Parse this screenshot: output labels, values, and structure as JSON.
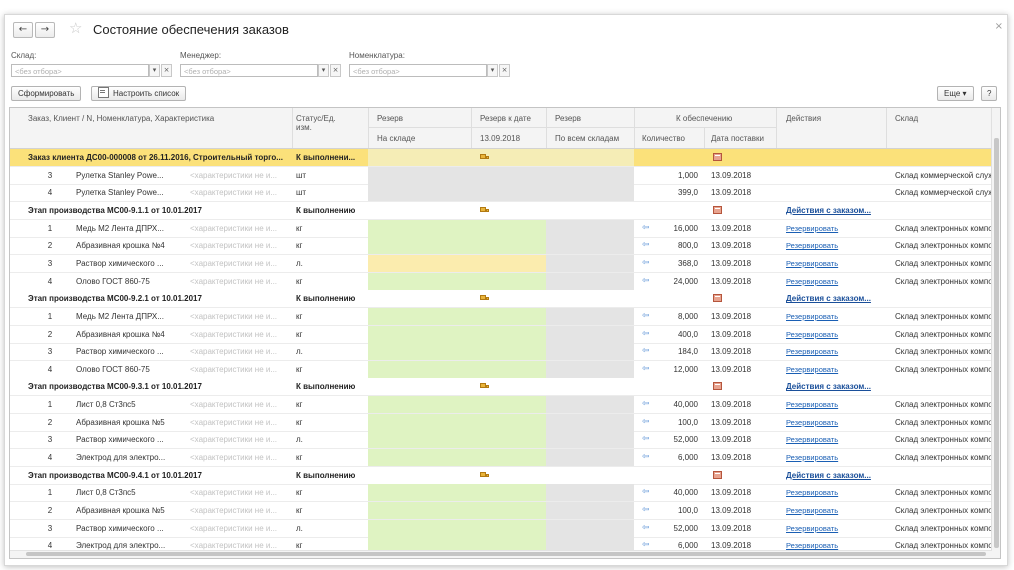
{
  "window": {
    "title": "Состояние обеспечения заказов",
    "back": "←",
    "forward": "→",
    "star": "☆",
    "close": "×"
  },
  "filters": [
    {
      "label": "Склад:",
      "placeholder": "<без отбора>"
    },
    {
      "label": "Менеджер:",
      "placeholder": "<без отбора>"
    },
    {
      "label": "Номенклатура:",
      "placeholder": "<без отбора>"
    }
  ],
  "filter_btn_dropdown": "▾",
  "filter_btn_clear": "×",
  "toolbar": {
    "generate": "Сформировать",
    "configure": "Настроить список",
    "more": "Еще",
    "more_arrow": "▾",
    "help": "?"
  },
  "columns": {
    "order": "Заказ, Клиент / N, Номенклатура, Характеристика",
    "status": "Статус/Ед.",
    "status2": "изм.",
    "reserve": "Резерв",
    "reserve_date": "Резерв к дате",
    "reserve_all": "Резерв",
    "to_supply": "К обеспечению",
    "actions": "Действия",
    "warehouse": "Склад",
    "sub_in_stock": "На складе",
    "sub_date": "13.09.2018",
    "sub_all_wh": "По всем складам",
    "sub_qty": "Количество",
    "sub_delivery": "Дата поставки"
  },
  "rows": [
    {
      "type": "order",
      "title": "Заказ клиента ДС00-000008 от 26.11.2016, Строительный торго...",
      "status": "К выполнени..."
    },
    {
      "type": "item",
      "n": "3",
      "name": "Рулетка Stanley Powe...",
      "char": "<характеристики не и...",
      "unit": "шт",
      "fill": "grey",
      "qty": "1,000",
      "date": "13.09.2018",
      "warehouse": "Склад коммерческой служ",
      "arrow": false,
      "action": ""
    },
    {
      "type": "item",
      "n": "4",
      "name": "Рулетка Stanley Powe...",
      "char": "<характеристики не и...",
      "unit": "шт",
      "fill": "grey",
      "qty": "399,0",
      "date": "13.09.2018",
      "warehouse": "Склад коммерческой служ",
      "arrow": false,
      "action": ""
    },
    {
      "type": "stage",
      "title": "Этап производства МС00-9.1.1 от 10.01.2017",
      "status": "К выполнению",
      "action": "Действия с заказом..."
    },
    {
      "type": "item",
      "n": "1",
      "name": "Медь М2 Лента ДПРХ...",
      "char": "<характеристики не и...",
      "unit": "кг",
      "fill": "green",
      "qty": "16,000",
      "date": "13.09.2018",
      "warehouse": "Склад электронных компо",
      "arrow": true,
      "action": "Резервировать"
    },
    {
      "type": "item",
      "n": "2",
      "name": "Абразивная крошка №4",
      "char": "<характеристики не и...",
      "unit": "кг",
      "fill": "green",
      "qty": "800,0",
      "date": "13.09.2018",
      "warehouse": "Склад электронных компо",
      "arrow": true,
      "action": "Резервировать"
    },
    {
      "type": "item",
      "n": "3",
      "name": "Раствор химического ...",
      "char": "<характеристики не и...",
      "unit": "л.",
      "fill": "yellow",
      "qty": "368,0",
      "date": "13.09.2018",
      "warehouse": "Склад электронных компо",
      "arrow": true,
      "action": "Резервировать"
    },
    {
      "type": "item",
      "n": "4",
      "name": "Олово ГОСТ 860-75",
      "char": "<характеристики не и...",
      "unit": "кг",
      "fill": "green",
      "qty": "24,000",
      "date": "13.09.2018",
      "warehouse": "Склад электронных компо",
      "arrow": true,
      "action": "Резервировать"
    },
    {
      "type": "stage",
      "title": "Этап производства МС00-9.2.1 от 10.01.2017",
      "status": "К выполнению",
      "action": "Действия с заказом..."
    },
    {
      "type": "item",
      "n": "1",
      "name": "Медь М2 Лента ДПРХ...",
      "char": "<характеристики не и...",
      "unit": "кг",
      "fill": "green",
      "qty": "8,000",
      "date": "13.09.2018",
      "warehouse": "Склад электронных компо",
      "arrow": true,
      "action": "Резервировать"
    },
    {
      "type": "item",
      "n": "2",
      "name": "Абразивная крошка №4",
      "char": "<характеристики не и...",
      "unit": "кг",
      "fill": "green",
      "qty": "400,0",
      "date": "13.09.2018",
      "warehouse": "Склад электронных компо",
      "arrow": true,
      "action": "Резервировать"
    },
    {
      "type": "item",
      "n": "3",
      "name": "Раствор химического ...",
      "char": "<характеристики не и...",
      "unit": "л.",
      "fill": "green",
      "qty": "184,0",
      "date": "13.09.2018",
      "warehouse": "Склад электронных компо",
      "arrow": true,
      "action": "Резервировать"
    },
    {
      "type": "item",
      "n": "4",
      "name": "Олово ГОСТ 860-75",
      "char": "<характеристики не и...",
      "unit": "кг",
      "fill": "green",
      "qty": "12,000",
      "date": "13.09.2018",
      "warehouse": "Склад электронных компо",
      "arrow": true,
      "action": "Резервировать"
    },
    {
      "type": "stage",
      "title": "Этап производства МС00-9.3.1 от 10.01.2017",
      "status": "К выполнению",
      "action": "Действия с заказом..."
    },
    {
      "type": "item",
      "n": "1",
      "name": "Лист 0,8 Ст3пс5",
      "char": "<характеристики не и...",
      "unit": "кг",
      "fill": "green",
      "qty": "40,000",
      "date": "13.09.2018",
      "warehouse": "Склад электронных компо",
      "arrow": true,
      "action": "Резервировать"
    },
    {
      "type": "item",
      "n": "2",
      "name": "Абразивная крошка №5",
      "char": "<характеристики не и...",
      "unit": "кг",
      "fill": "green",
      "qty": "100,0",
      "date": "13.09.2018",
      "warehouse": "Склад электронных компо",
      "arrow": true,
      "action": "Резервировать"
    },
    {
      "type": "item",
      "n": "3",
      "name": "Раствор химического ...",
      "char": "<характеристики не и...",
      "unit": "л.",
      "fill": "green",
      "qty": "52,000",
      "date": "13.09.2018",
      "warehouse": "Склад электронных компо",
      "arrow": true,
      "action": "Резервировать"
    },
    {
      "type": "item",
      "n": "4",
      "name": "Электрод для электро...",
      "char": "<характеристики не и...",
      "unit": "кг",
      "fill": "green",
      "qty": "6,000",
      "date": "13.09.2018",
      "warehouse": "Склад электронных компо",
      "arrow": true,
      "action": "Резервировать"
    },
    {
      "type": "stage",
      "title": "Этап производства МС00-9.4.1 от 10.01.2017",
      "status": "К выполнению",
      "action": "Действия с заказом..."
    },
    {
      "type": "item",
      "n": "1",
      "name": "Лист 0,8 Ст3пс5",
      "char": "<характеристики не и...",
      "unit": "кг",
      "fill": "green",
      "qty": "40,000",
      "date": "13.09.2018",
      "warehouse": "Склад электронных компо",
      "arrow": true,
      "action": "Резервировать"
    },
    {
      "type": "item",
      "n": "2",
      "name": "Абразивная крошка №5",
      "char": "<характеристики не и...",
      "unit": "кг",
      "fill": "green",
      "qty": "100,0",
      "date": "13.09.2018",
      "warehouse": "Склад электронных компо",
      "arrow": true,
      "action": "Резервировать"
    },
    {
      "type": "item",
      "n": "3",
      "name": "Раствор химического ...",
      "char": "<характеристики не и...",
      "unit": "л.",
      "fill": "green",
      "qty": "52,000",
      "date": "13.09.2018",
      "warehouse": "Склад электронных компо",
      "arrow": true,
      "action": "Резервировать"
    },
    {
      "type": "item",
      "n": "4",
      "name": "Электрод для электро...",
      "char": "<характеристики не и...",
      "unit": "кг",
      "fill": "green",
      "qty": "6,000",
      "date": "13.09.2018",
      "warehouse": "Склад электронных компо",
      "arrow": true,
      "action": "Резервировать"
    }
  ],
  "icons": {
    "truck": "truck-icon",
    "calendar": "calendar-icon",
    "arrow": "arrow-left-icon"
  },
  "colors": {
    "order_row": "#fbe17a",
    "reserve_green": "#dff3c2",
    "reserve_grey": "#e4e4e4",
    "reserve_yellow": "#fbecae",
    "link": "#1a5fb4"
  },
  "arrow_glyph": "⇦"
}
